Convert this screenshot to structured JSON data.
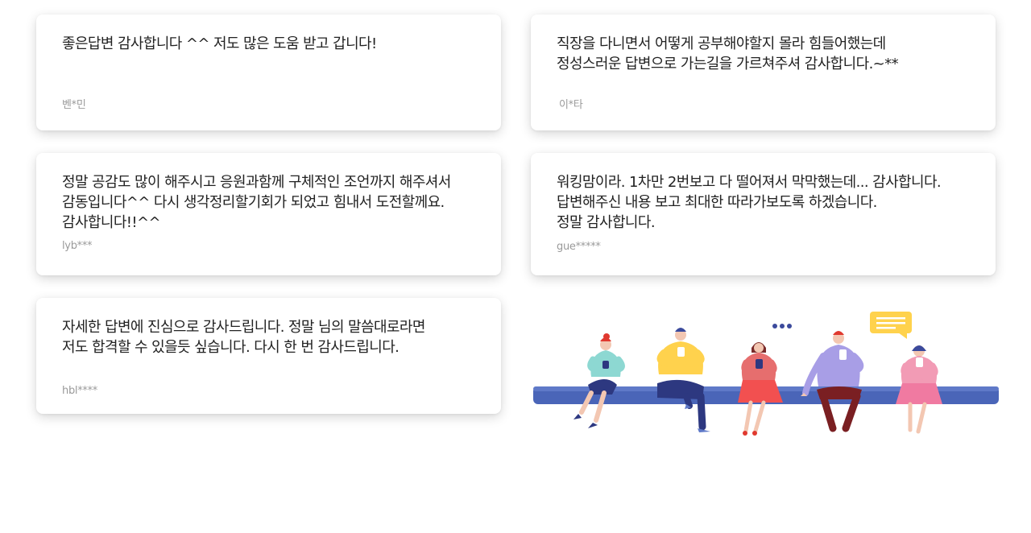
{
  "reviews": [
    {
      "text_lines": [
        "좋은답변 감사합니다 ^^ 저도 많은 도움 받고 갑니다!"
      ],
      "author": "벤*민"
    },
    {
      "text_lines": [
        "직장을 다니면서 어떻게 공부해야할지 몰라 힘들어했는데",
        "정성스러운 답변으로 가는길을 가르쳐주셔 감사합니다.~**"
      ],
      "author": "이*타"
    },
    {
      "text_lines": [
        "정말 공감도 많이 해주시고 응원과함께 구체적인 조언까지 해주셔서",
        "감동입니다^^ 다시 생각정리할기회가 되었고 힘내서 도전할께요.",
        "감사합니다!!^^"
      ],
      "author": "lyb***"
    },
    {
      "text_lines": [
        "워킹맘이라. 1차만 2번보고 다 떨어져서 막막했는데... 감사합니다.",
        "답변해주신 내용 보고 최대한 따라가보도록 하겠습니다.",
        "정말 감사합니다."
      ],
      "author": "gue*****"
    },
    {
      "text_lines": [
        "자세한 답변에 진심으로 감사드립니다. 정말 님의 말씀대로라면",
        "저도 합격할 수 있을듯 싶습니다. 다시 한 번 감사드립니다."
      ],
      "author": "hbl****"
    }
  ],
  "illustration": {
    "icons": [
      "people-on-bench-illustration",
      "typing-dots-icon",
      "speech-bubble-icon"
    ],
    "colors": {
      "bench": "#4a65b8",
      "bubble": "#ffd24d",
      "dots": "#3b4a9c"
    }
  }
}
